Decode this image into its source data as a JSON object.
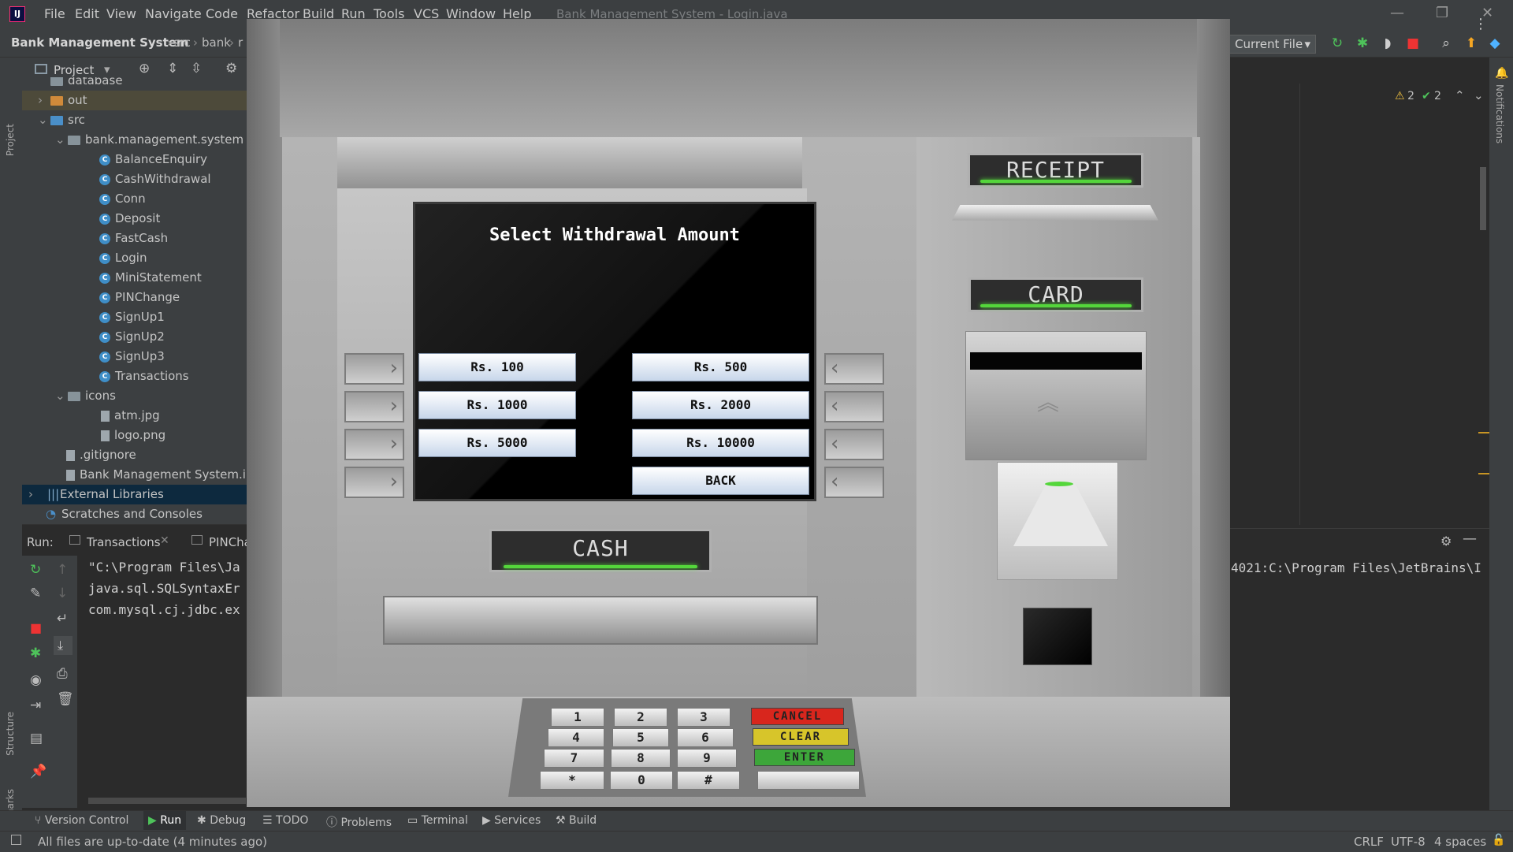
{
  "ide": {
    "logo_text": "IJ",
    "menu": [
      "File",
      "Edit",
      "View",
      "Navigate",
      "Code",
      "Refactor",
      "Build",
      "Run",
      "Tools",
      "VCS",
      "Window",
      "Help"
    ],
    "window_title": "Bank Management System - Login.java",
    "breadcrumbs": [
      "Bank Management System",
      "src",
      "bank",
      "r"
    ],
    "run_config": "Current File",
    "inspections": {
      "warnings": "2",
      "ok": "2"
    }
  },
  "left_strip": {
    "project": "Project",
    "structure": "Structure",
    "bookmarks": "Bookmarks"
  },
  "right_strip": {
    "notifications": "Notifications"
  },
  "project_panel": {
    "title": "Project",
    "tree": [
      {
        "label": "database",
        "type": "folder"
      },
      {
        "label": "out",
        "type": "folder-orange"
      },
      {
        "label": "src",
        "type": "folder-blue"
      },
      {
        "label": "bank.management.system",
        "type": "package"
      },
      {
        "label": "BalanceEnquiry",
        "type": "class"
      },
      {
        "label": "CashWithdrawal",
        "type": "class"
      },
      {
        "label": "Conn",
        "type": "class"
      },
      {
        "label": "Deposit",
        "type": "class"
      },
      {
        "label": "FastCash",
        "type": "class"
      },
      {
        "label": "Login",
        "type": "class"
      },
      {
        "label": "MiniStatement",
        "type": "class"
      },
      {
        "label": "PINChange",
        "type": "class"
      },
      {
        "label": "SignUp1",
        "type": "class"
      },
      {
        "label": "SignUp2",
        "type": "class"
      },
      {
        "label": "SignUp3",
        "type": "class"
      },
      {
        "label": "Transactions",
        "type": "class"
      },
      {
        "label": "icons",
        "type": "package"
      },
      {
        "label": "atm.jpg",
        "type": "file"
      },
      {
        "label": "logo.png",
        "type": "file"
      },
      {
        "label": ".gitignore",
        "type": "file"
      },
      {
        "label": "Bank Management System.iml",
        "type": "file"
      },
      {
        "label": "External Libraries",
        "type": "lib"
      },
      {
        "label": "Scratches and Consoles",
        "type": "scratch"
      }
    ]
  },
  "run_panel": {
    "label": "Run:",
    "tabs": [
      "Transactions",
      "PINCha"
    ],
    "console": [
      "\"C:\\Program Files\\Ja",
      "java.sql.SQLSyntaxEr",
      "com.mysql.cj.jdbc.ex"
    ],
    "console_right": "4021:C:\\Program Files\\JetBrains\\I"
  },
  "bottom_tabs": [
    "Version Control",
    "Run",
    "Debug",
    "TODO",
    "Problems",
    "Terminal",
    "Services",
    "Build"
  ],
  "status": {
    "message": "All files are up-to-date (4 minutes ago)",
    "line_sep": "CRLF",
    "encoding": "UTF-8",
    "indent": "4 spaces"
  },
  "atm": {
    "screen_title": "Select Withdrawal Amount",
    "buttons_left": [
      "Rs. 100",
      "Rs. 1000",
      "Rs. 5000"
    ],
    "buttons_right": [
      "Rs. 500",
      "Rs. 2000",
      "Rs. 10000",
      "BACK"
    ],
    "slot_receipt": "RECEIPT",
    "slot_card": "CARD",
    "slot_cash": "CASH",
    "keypad_digits": [
      "1",
      "2",
      "3",
      "4",
      "5",
      "6",
      "7",
      "8",
      "9",
      "*",
      "0",
      "#"
    ],
    "keypad_functions": [
      {
        "label": "CANCEL",
        "color": "#d8261d"
      },
      {
        "label": "CLEAR",
        "color": "#d7c52a"
      },
      {
        "label": "ENTER",
        "color": "#3da63a"
      }
    ]
  }
}
